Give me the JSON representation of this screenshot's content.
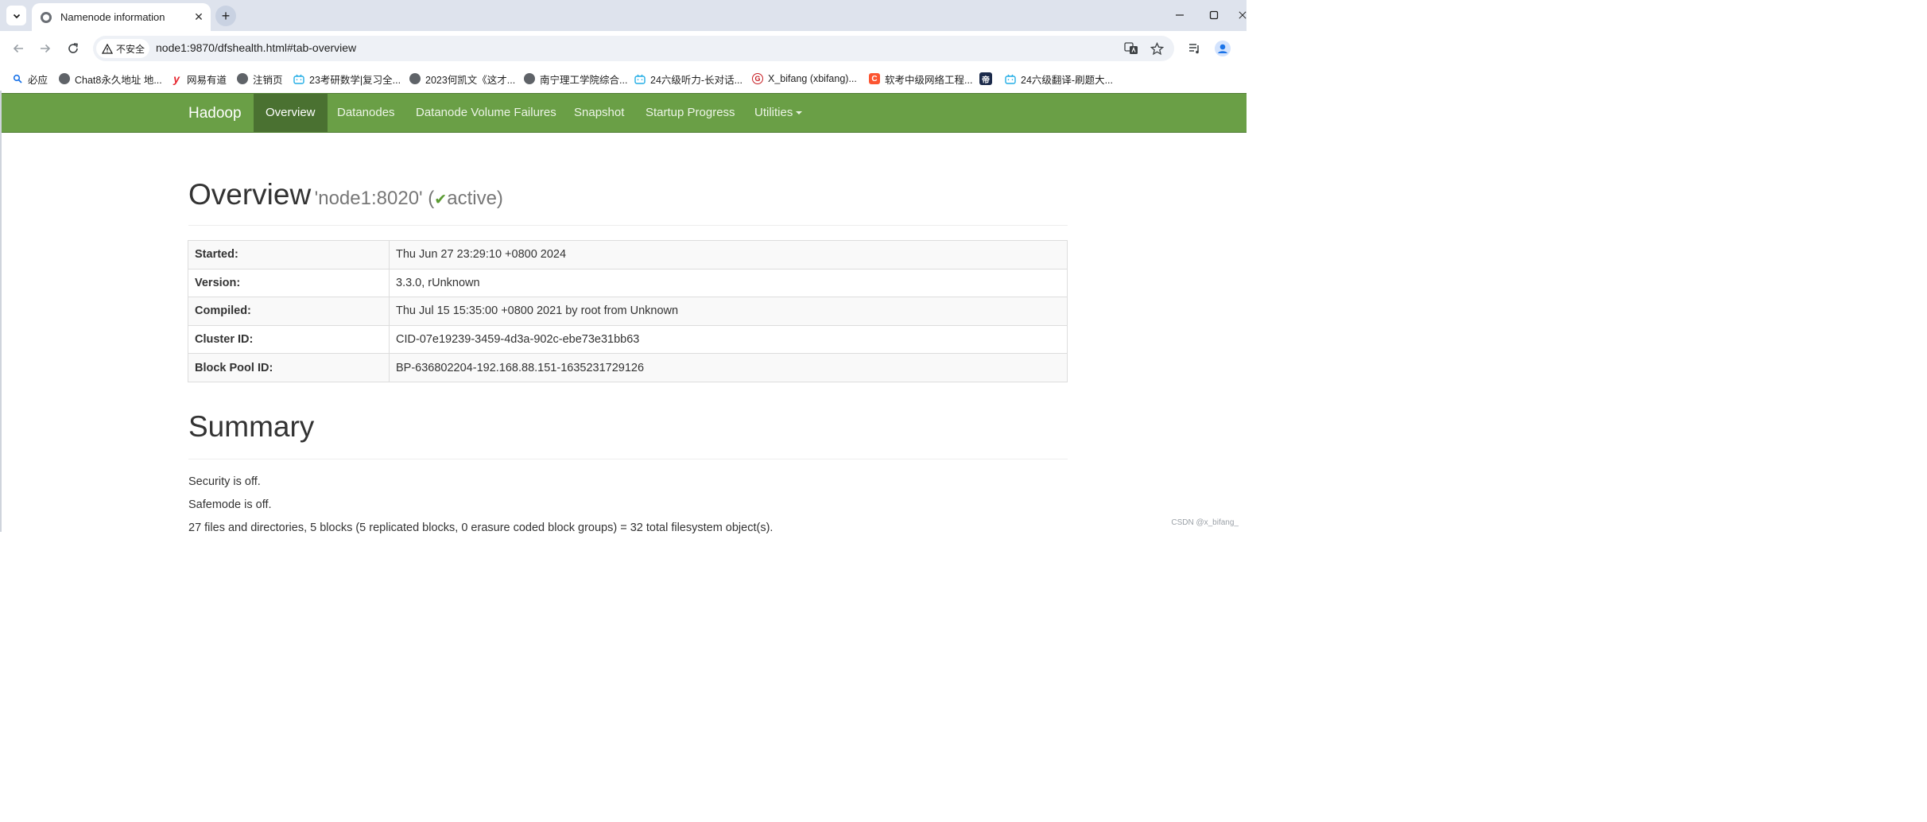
{
  "browser": {
    "tab_title": "Namenode information",
    "close_glyph": "✕",
    "new_tab_glyph": "+",
    "security_label": "不安全",
    "url": "node1:9870/dfshealth.html#tab-overview",
    "bookmarks": [
      {
        "label": "必应",
        "icon": "bing-icon"
      },
      {
        "label": "Chat8永久地址 地...",
        "icon": "globe-icon"
      },
      {
        "label": "网易有道",
        "icon": "youdao-icon"
      },
      {
        "label": "注销页",
        "icon": "globe-icon"
      },
      {
        "label": "23考研数学|复习全...",
        "icon": "bilibili-icon"
      },
      {
        "label": "2023何凯文《这才...",
        "icon": "globe-icon"
      },
      {
        "label": "南宁理工学院综合...",
        "icon": "globe-icon"
      },
      {
        "label": "24六级听力-长对话...",
        "icon": "bilibili-icon"
      },
      {
        "label": "X_bifang (xbifang)...",
        "icon": "gitee-icon"
      },
      {
        "label": "软考中级网络工程...",
        "icon": "csdn-icon"
      },
      {
        "label": "",
        "icon": "di-icon"
      },
      {
        "label": "24六级翻译-刷题大...",
        "icon": "bilibili-icon"
      }
    ],
    "di_glyph": "帝",
    "gitee_glyph": "G",
    "csdn_glyph": "C",
    "youdao_glyph": "y"
  },
  "navbar": {
    "brand": "Hadoop",
    "items": [
      {
        "label": "Overview",
        "active": true
      },
      {
        "label": "Datanodes",
        "active": false
      },
      {
        "label": "Datanode Volume Failures",
        "active": false
      },
      {
        "label": "Snapshot",
        "active": false
      },
      {
        "label": "Startup Progress",
        "active": false
      },
      {
        "label": "Utilities",
        "active": false,
        "dropdown": true
      }
    ]
  },
  "overview": {
    "title": "Overview",
    "node": "'node1:8020'",
    "paren_open": "(",
    "check_glyph": "✔",
    "state": "active",
    "paren_close": ")",
    "rows": [
      {
        "key": "Started:",
        "value": "Thu Jun 27 23:29:10 +0800 2024"
      },
      {
        "key": "Version:",
        "value": "3.3.0, rUnknown"
      },
      {
        "key": "Compiled:",
        "value": "Thu Jul 15 15:35:00 +0800 2021 by root from Unknown"
      },
      {
        "key": "Cluster ID:",
        "value": "CID-07e19239-3459-4d3a-902c-ebe73e31bb63"
      },
      {
        "key": "Block Pool ID:",
        "value": "BP-636802204-192.168.88.151-1635231729126"
      }
    ]
  },
  "summary": {
    "title": "Summary",
    "security": "Security is off.",
    "safemode": "Safemode is off.",
    "files_line": "27 files and directories, 5 blocks (5 replicated blocks, 0 erasure coded block groups) = 32 total filesystem object(s)."
  },
  "watermark": "CSDN @x_bifang_",
  "colors": {
    "navbar": "#6a9f46",
    "navbar_active": "#4a7131",
    "tabstrip": "#dee3ed",
    "active_check": "#5a9a32"
  }
}
